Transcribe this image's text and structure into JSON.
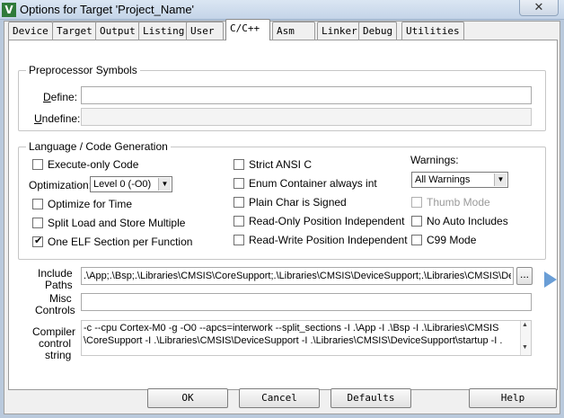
{
  "window": {
    "icon": "V",
    "title": "Options for Target 'Project_Name'",
    "close_glyph": "✕"
  },
  "tabs": [
    {
      "label": "Device"
    },
    {
      "label": "Target"
    },
    {
      "label": "Output"
    },
    {
      "label": "Listing"
    },
    {
      "label": "User"
    },
    {
      "label": "C/C++"
    },
    {
      "label": "Asm"
    },
    {
      "label": "Linker"
    },
    {
      "label": "Debug"
    },
    {
      "label": "Utilities"
    }
  ],
  "active_tab": "C/C++",
  "preprocessor": {
    "group_label": "Preprocessor Symbols",
    "define_label": "Define:",
    "define_value": "",
    "undefine_label": "Undefine:",
    "undefine_value": ""
  },
  "language": {
    "group_label": "Language / Code Generation",
    "execute_only": {
      "label": "Execute-only Code",
      "checked": false
    },
    "optimization_label": "Optimization:",
    "optimization_value": "Level 0 (-O0)",
    "optimize_time": {
      "label": "Optimize for Time",
      "checked": false
    },
    "split_load": {
      "label": "Split Load and Store Multiple",
      "checked": false
    },
    "one_elf": {
      "label": "One ELF Section per Function",
      "checked": true,
      "check_glyph": "✔"
    },
    "strict_ansi": {
      "label": "Strict ANSI C",
      "checked": false
    },
    "enum_container": {
      "label": "Enum Container always int",
      "checked": false
    },
    "plain_char": {
      "label": "Plain Char is Signed",
      "checked": false
    },
    "ro_pos": {
      "label": "Read-Only Position Independent",
      "checked": false
    },
    "rw_pos": {
      "label": "Read-Write Position Independent",
      "checked": false
    },
    "warnings_label": "Warnings:",
    "warnings_value": "All Warnings",
    "thumb_mode": {
      "label": "Thumb Mode",
      "checked": false,
      "disabled": true
    },
    "no_auto_includes": {
      "label": "No Auto Includes",
      "checked": false
    },
    "c99_mode": {
      "label": "C99 Mode",
      "checked": false
    }
  },
  "include_paths": {
    "label_line1": "Include",
    "label_line2": "Paths",
    "value": ".\\App;.\\Bsp;.\\Libraries\\CMSIS\\CoreSupport;.\\Libraries\\CMSIS\\DeviceSupport;.\\Libraries\\CMSIS\\De",
    "browse_label": "..."
  },
  "misc_controls": {
    "label_line1": "Misc",
    "label_line2": "Controls",
    "value": ""
  },
  "compiler_string": {
    "label_line1": "Compiler",
    "label_line2": "control",
    "label_line3": "string",
    "line1": "-c --cpu Cortex-M0 -g -O0 --apcs=interwork --split_sections -I .\\App -I .\\Bsp -I .\\Libraries\\CMSIS",
    "line2": "\\CoreSupport -I .\\Libraries\\CMSIS\\DeviceSupport -I .\\Libraries\\CMSIS\\DeviceSupport\\startup -I ."
  },
  "buttons": {
    "ok": "OK",
    "cancel": "Cancel",
    "defaults": "Defaults",
    "help": "Help"
  },
  "icons": {
    "dropdown": "chevron-down-icon",
    "scroll_up": "scroll-up-icon",
    "scroll_down": "scroll-down-icon",
    "checkmark": "checkmark-icon"
  },
  "colors": {
    "titlebar": "#c4d4e8",
    "dialog_bg": "#f0f0f0",
    "panel_bg": "#ffffff"
  }
}
